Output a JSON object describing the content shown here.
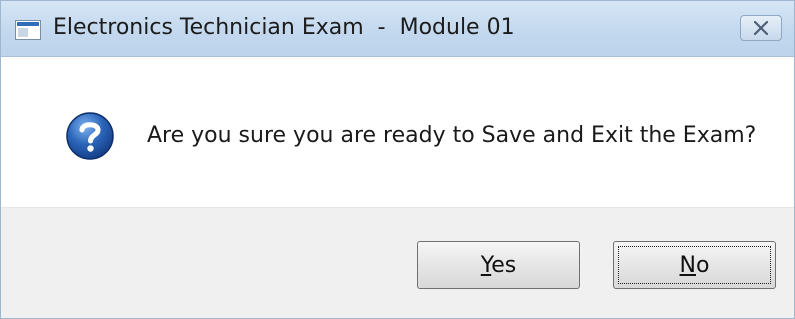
{
  "window": {
    "title": "Electronics Technician Exam  -  Module 01",
    "icons": {
      "app": "app-window-icon",
      "close": "close-icon"
    }
  },
  "message": {
    "icon": "question-icon",
    "text": "Are you sure you are ready to Save and Exit the Exam?"
  },
  "buttons": {
    "yes": {
      "first": "Y",
      "rest": "es"
    },
    "no": {
      "first": "N",
      "rest": "o",
      "focused": true
    }
  },
  "colors": {
    "titlebar": "#c3d8ee",
    "question_icon": "#1f57a8",
    "footer": "#f0f0f0"
  }
}
